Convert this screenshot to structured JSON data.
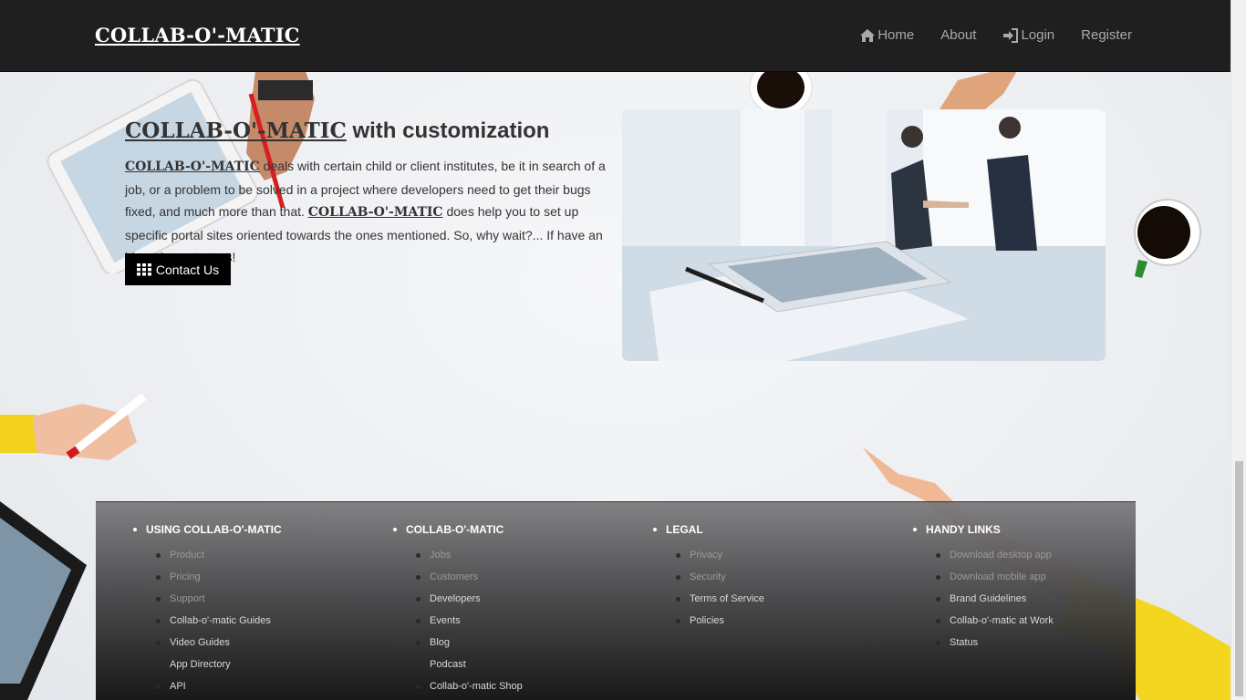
{
  "navbar": {
    "brand": "COLLAB-O'-MATIC",
    "items": [
      {
        "label": "Home",
        "icon": "home-icon"
      },
      {
        "label": "About"
      },
      {
        "label": "Login",
        "icon": "login-icon"
      },
      {
        "label": "Register"
      }
    ]
  },
  "hero": {
    "title_brand": "COLLAB-O'-MATIC",
    "title_rest": " with customization",
    "text_brand_1": "COLLAB-O'-MATIC",
    "text_part_1": " deals with certain child or client institutes, be it in search of a job, or a problem to be solved in a project where developers need to get their bugs fixed, and much more than that. ",
    "text_brand_2": "COLLAB-O'-MATIC",
    "text_part_2": " does help you to set up specific portal sites oriented towards the ones mentioned. So, why wait?... If have an idea, do contact us!",
    "button_label": "Contact Us"
  },
  "footer": {
    "columns": [
      {
        "heading": "USING COLLAB-O'-MATIC",
        "links": [
          "Product",
          "Pricing",
          "Support",
          "Collab-o'-matic Guides",
          "Video Guides",
          "App Directory",
          "API"
        ]
      },
      {
        "heading": "COLLAB-O'-MATIC",
        "links": [
          "Jobs",
          "Customers",
          "Developers",
          "Events",
          "Blog",
          "Podcast",
          "Collab-o'-matic Shop"
        ]
      },
      {
        "heading": "LEGAL",
        "links": [
          "Privacy",
          "Security",
          "Terms of Service",
          "Policies"
        ]
      },
      {
        "heading": "HANDY LINKS",
        "links": [
          "Download desktop app",
          "Download mobile app",
          "Brand Guidelines",
          "Collab-o'-matic at Work",
          "Status"
        ]
      }
    ]
  },
  "colors": {
    "navbar_bg": "#1f1f1f",
    "button_bg": "#000000",
    "text": "#333333"
  }
}
